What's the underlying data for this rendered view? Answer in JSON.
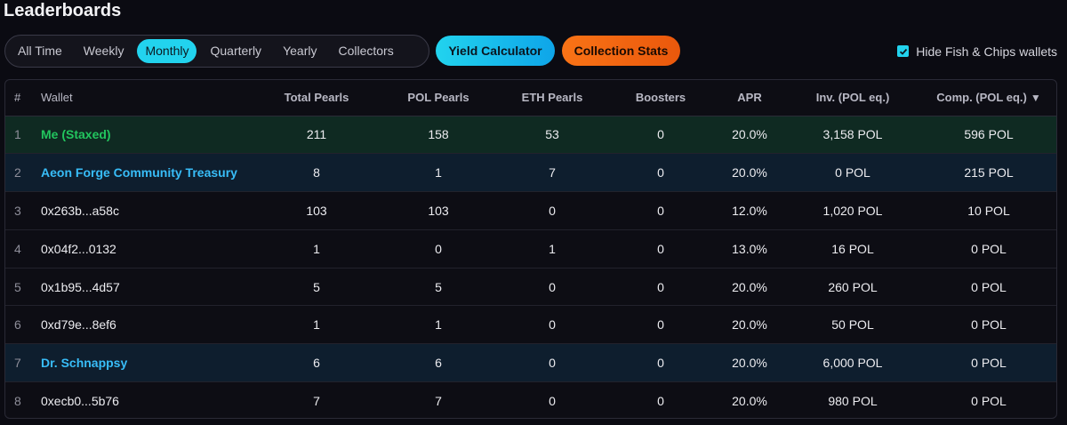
{
  "page": {
    "title": "Leaderboards"
  },
  "tabs": [
    {
      "label": "All Time"
    },
    {
      "label": "Weekly"
    },
    {
      "label": "Monthly"
    },
    {
      "label": "Quarterly"
    },
    {
      "label": "Yearly"
    },
    {
      "label": "Collectors"
    }
  ],
  "active_tab": "Monthly",
  "buttons": {
    "yield": "Yield Calculator",
    "stats": "Collection Stats"
  },
  "filter": {
    "label": "Hide Fish & Chips wallets",
    "checked": true
  },
  "table": {
    "headers": {
      "rank": "#",
      "wallet": "Wallet",
      "total": "Total Pearls",
      "pol": "POL Pearls",
      "eth": "ETH Pearls",
      "boosters": "Boosters",
      "apr": "APR",
      "inv": "Inv. (POL eq.)",
      "comp": "Comp. (POL eq.)"
    },
    "sort_indicator": "▼",
    "rows": [
      {
        "rank": "1",
        "wallet": "Me (Staxed)",
        "total": "211",
        "pol": "158",
        "eth": "53",
        "boosters": "0",
        "apr": "20.0%",
        "inv": "3,158 POL",
        "comp": "596 POL"
      },
      {
        "rank": "2",
        "wallet": "Aeon Forge Community Treasury",
        "total": "8",
        "pol": "1",
        "eth": "7",
        "boosters": "0",
        "apr": "20.0%",
        "inv": "0 POL",
        "comp": "215 POL"
      },
      {
        "rank": "3",
        "wallet": "0x263b...a58c",
        "total": "103",
        "pol": "103",
        "eth": "0",
        "boosters": "0",
        "apr": "12.0%",
        "inv": "1,020 POL",
        "comp": "10 POL"
      },
      {
        "rank": "4",
        "wallet": "0x04f2...0132",
        "total": "1",
        "pol": "0",
        "eth": "1",
        "boosters": "0",
        "apr": "13.0%",
        "inv": "16 POL",
        "comp": "0 POL"
      },
      {
        "rank": "5",
        "wallet": "0x1b95...4d57",
        "total": "5",
        "pol": "5",
        "eth": "0",
        "boosters": "0",
        "apr": "20.0%",
        "inv": "260 POL",
        "comp": "0 POL"
      },
      {
        "rank": "6",
        "wallet": "0xd79e...8ef6",
        "total": "1",
        "pol": "1",
        "eth": "0",
        "boosters": "0",
        "apr": "20.0%",
        "inv": "50 POL",
        "comp": "0 POL"
      },
      {
        "rank": "7",
        "wallet": "Dr. Schnappsy",
        "total": "6",
        "pol": "6",
        "eth": "0",
        "boosters": "0",
        "apr": "20.0%",
        "inv": "6,000 POL",
        "comp": "0 POL"
      },
      {
        "rank": "8",
        "wallet": "0xecb0...5b76",
        "total": "7",
        "pol": "7",
        "eth": "0",
        "boosters": "0",
        "apr": "20.0%",
        "inv": "980 POL",
        "comp": "0 POL"
      }
    ]
  }
}
